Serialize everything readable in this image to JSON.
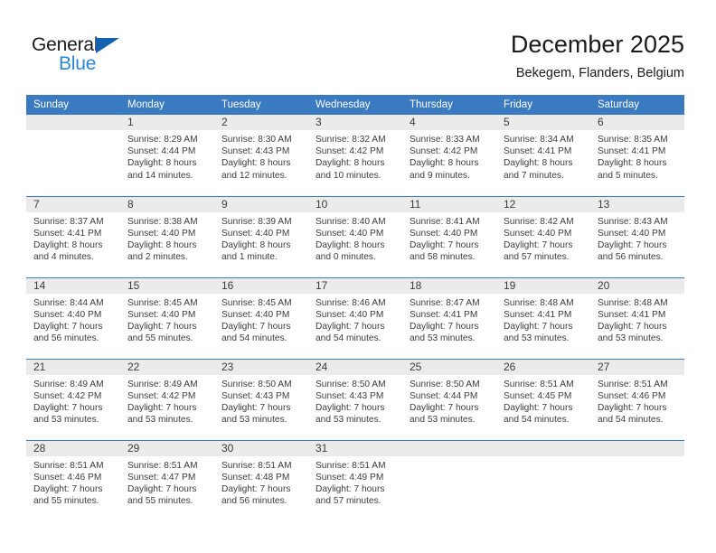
{
  "brand": {
    "word_one": "General",
    "word_two": "Blue",
    "triangle_color": "#1462ae",
    "blue_color": "#2b87d8"
  },
  "header": {
    "month_title": "December 2025",
    "location": "Bekegem, Flanders, Belgium"
  },
  "theme": {
    "header_blue": "#3a7ac0",
    "daynum_gray": "#ebebeb",
    "text": "#3c3c3c"
  },
  "weekday_headers": [
    "Sunday",
    "Monday",
    "Tuesday",
    "Wednesday",
    "Thursday",
    "Friday",
    "Saturday"
  ],
  "weeks": [
    [
      {
        "day": "",
        "sunrise": "",
        "sunset": "",
        "daylight_1": "",
        "daylight_2": ""
      },
      {
        "day": "1",
        "sunrise": "Sunrise: 8:29 AM",
        "sunset": "Sunset: 4:44 PM",
        "daylight_1": "Daylight: 8 hours",
        "daylight_2": "and 14 minutes."
      },
      {
        "day": "2",
        "sunrise": "Sunrise: 8:30 AM",
        "sunset": "Sunset: 4:43 PM",
        "daylight_1": "Daylight: 8 hours",
        "daylight_2": "and 12 minutes."
      },
      {
        "day": "3",
        "sunrise": "Sunrise: 8:32 AM",
        "sunset": "Sunset: 4:42 PM",
        "daylight_1": "Daylight: 8 hours",
        "daylight_2": "and 10 minutes."
      },
      {
        "day": "4",
        "sunrise": "Sunrise: 8:33 AM",
        "sunset": "Sunset: 4:42 PM",
        "daylight_1": "Daylight: 8 hours",
        "daylight_2": "and 9 minutes."
      },
      {
        "day": "5",
        "sunrise": "Sunrise: 8:34 AM",
        "sunset": "Sunset: 4:41 PM",
        "daylight_1": "Daylight: 8 hours",
        "daylight_2": "and 7 minutes."
      },
      {
        "day": "6",
        "sunrise": "Sunrise: 8:35 AM",
        "sunset": "Sunset: 4:41 PM",
        "daylight_1": "Daylight: 8 hours",
        "daylight_2": "and 5 minutes."
      }
    ],
    [
      {
        "day": "7",
        "sunrise": "Sunrise: 8:37 AM",
        "sunset": "Sunset: 4:41 PM",
        "daylight_1": "Daylight: 8 hours",
        "daylight_2": "and 4 minutes."
      },
      {
        "day": "8",
        "sunrise": "Sunrise: 8:38 AM",
        "sunset": "Sunset: 4:40 PM",
        "daylight_1": "Daylight: 8 hours",
        "daylight_2": "and 2 minutes."
      },
      {
        "day": "9",
        "sunrise": "Sunrise: 8:39 AM",
        "sunset": "Sunset: 4:40 PM",
        "daylight_1": "Daylight: 8 hours",
        "daylight_2": "and 1 minute."
      },
      {
        "day": "10",
        "sunrise": "Sunrise: 8:40 AM",
        "sunset": "Sunset: 4:40 PM",
        "daylight_1": "Daylight: 8 hours",
        "daylight_2": "and 0 minutes."
      },
      {
        "day": "11",
        "sunrise": "Sunrise: 8:41 AM",
        "sunset": "Sunset: 4:40 PM",
        "daylight_1": "Daylight: 7 hours",
        "daylight_2": "and 58 minutes."
      },
      {
        "day": "12",
        "sunrise": "Sunrise: 8:42 AM",
        "sunset": "Sunset: 4:40 PM",
        "daylight_1": "Daylight: 7 hours",
        "daylight_2": "and 57 minutes."
      },
      {
        "day": "13",
        "sunrise": "Sunrise: 8:43 AM",
        "sunset": "Sunset: 4:40 PM",
        "daylight_1": "Daylight: 7 hours",
        "daylight_2": "and 56 minutes."
      }
    ],
    [
      {
        "day": "14",
        "sunrise": "Sunrise: 8:44 AM",
        "sunset": "Sunset: 4:40 PM",
        "daylight_1": "Daylight: 7 hours",
        "daylight_2": "and 56 minutes."
      },
      {
        "day": "15",
        "sunrise": "Sunrise: 8:45 AM",
        "sunset": "Sunset: 4:40 PM",
        "daylight_1": "Daylight: 7 hours",
        "daylight_2": "and 55 minutes."
      },
      {
        "day": "16",
        "sunrise": "Sunrise: 8:45 AM",
        "sunset": "Sunset: 4:40 PM",
        "daylight_1": "Daylight: 7 hours",
        "daylight_2": "and 54 minutes."
      },
      {
        "day": "17",
        "sunrise": "Sunrise: 8:46 AM",
        "sunset": "Sunset: 4:40 PM",
        "daylight_1": "Daylight: 7 hours",
        "daylight_2": "and 54 minutes."
      },
      {
        "day": "18",
        "sunrise": "Sunrise: 8:47 AM",
        "sunset": "Sunset: 4:41 PM",
        "daylight_1": "Daylight: 7 hours",
        "daylight_2": "and 53 minutes."
      },
      {
        "day": "19",
        "sunrise": "Sunrise: 8:48 AM",
        "sunset": "Sunset: 4:41 PM",
        "daylight_1": "Daylight: 7 hours",
        "daylight_2": "and 53 minutes."
      },
      {
        "day": "20",
        "sunrise": "Sunrise: 8:48 AM",
        "sunset": "Sunset: 4:41 PM",
        "daylight_1": "Daylight: 7 hours",
        "daylight_2": "and 53 minutes."
      }
    ],
    [
      {
        "day": "21",
        "sunrise": "Sunrise: 8:49 AM",
        "sunset": "Sunset: 4:42 PM",
        "daylight_1": "Daylight: 7 hours",
        "daylight_2": "and 53 minutes."
      },
      {
        "day": "22",
        "sunrise": "Sunrise: 8:49 AM",
        "sunset": "Sunset: 4:42 PM",
        "daylight_1": "Daylight: 7 hours",
        "daylight_2": "and 53 minutes."
      },
      {
        "day": "23",
        "sunrise": "Sunrise: 8:50 AM",
        "sunset": "Sunset: 4:43 PM",
        "daylight_1": "Daylight: 7 hours",
        "daylight_2": "and 53 minutes."
      },
      {
        "day": "24",
        "sunrise": "Sunrise: 8:50 AM",
        "sunset": "Sunset: 4:43 PM",
        "daylight_1": "Daylight: 7 hours",
        "daylight_2": "and 53 minutes."
      },
      {
        "day": "25",
        "sunrise": "Sunrise: 8:50 AM",
        "sunset": "Sunset: 4:44 PM",
        "daylight_1": "Daylight: 7 hours",
        "daylight_2": "and 53 minutes."
      },
      {
        "day": "26",
        "sunrise": "Sunrise: 8:51 AM",
        "sunset": "Sunset: 4:45 PM",
        "daylight_1": "Daylight: 7 hours",
        "daylight_2": "and 54 minutes."
      },
      {
        "day": "27",
        "sunrise": "Sunrise: 8:51 AM",
        "sunset": "Sunset: 4:46 PM",
        "daylight_1": "Daylight: 7 hours",
        "daylight_2": "and 54 minutes."
      }
    ],
    [
      {
        "day": "28",
        "sunrise": "Sunrise: 8:51 AM",
        "sunset": "Sunset: 4:46 PM",
        "daylight_1": "Daylight: 7 hours",
        "daylight_2": "and 55 minutes."
      },
      {
        "day": "29",
        "sunrise": "Sunrise: 8:51 AM",
        "sunset": "Sunset: 4:47 PM",
        "daylight_1": "Daylight: 7 hours",
        "daylight_2": "and 55 minutes."
      },
      {
        "day": "30",
        "sunrise": "Sunrise: 8:51 AM",
        "sunset": "Sunset: 4:48 PM",
        "daylight_1": "Daylight: 7 hours",
        "daylight_2": "and 56 minutes."
      },
      {
        "day": "31",
        "sunrise": "Sunrise: 8:51 AM",
        "sunset": "Sunset: 4:49 PM",
        "daylight_1": "Daylight: 7 hours",
        "daylight_2": "and 57 minutes."
      },
      {
        "day": "",
        "sunrise": "",
        "sunset": "",
        "daylight_1": "",
        "daylight_2": ""
      },
      {
        "day": "",
        "sunrise": "",
        "sunset": "",
        "daylight_1": "",
        "daylight_2": ""
      },
      {
        "day": "",
        "sunrise": "",
        "sunset": "",
        "daylight_1": "",
        "daylight_2": ""
      }
    ]
  ]
}
